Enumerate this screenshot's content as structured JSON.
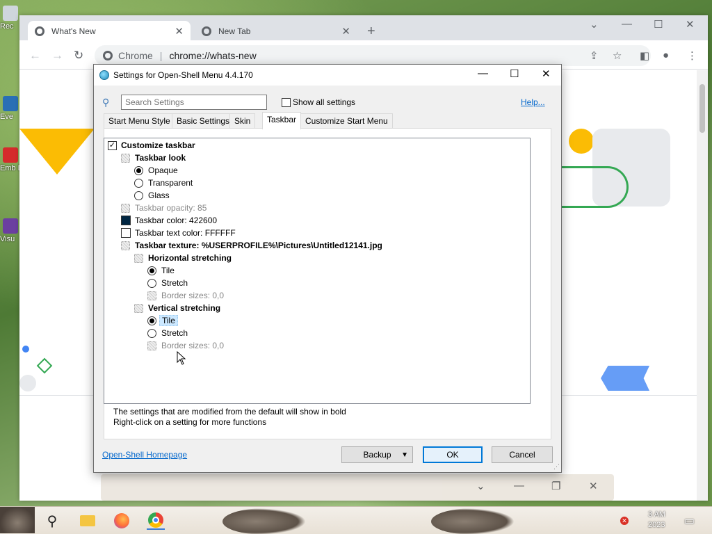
{
  "desktop": {
    "icons": [
      "Rec",
      "Eve",
      "Emb De",
      "Visu"
    ]
  },
  "chrome": {
    "tabs": [
      {
        "label": "What's New",
        "active": true
      },
      {
        "label": "New Tab",
        "active": false
      }
    ],
    "omnibox": {
      "site": "Chrome",
      "url": "chrome://whats-new"
    }
  },
  "dialog": {
    "title": "Settings for Open-Shell Menu 4.4.170",
    "search_placeholder": "Search Settings",
    "show_all_label": "Show all settings",
    "help_label": "Help...",
    "tabs": [
      "Start Menu Style",
      "Basic Settings",
      "Skin",
      "Taskbar",
      "Customize Start Menu"
    ],
    "active_tab": "Taskbar",
    "tree": {
      "customize_taskbar": "Customize taskbar",
      "taskbar_look": "Taskbar look",
      "opaque": "Opaque",
      "transparent": "Transparent",
      "glass": "Glass",
      "taskbar_opacity": "Taskbar opacity: 85",
      "taskbar_color": "Taskbar color: 422600",
      "taskbar_text_color": "Taskbar text color: FFFFFF",
      "taskbar_texture": "Taskbar texture: %USERPROFILE%\\Pictures\\Untitled12141.jpg",
      "horizontal_stretching": "Horizontal stretching",
      "h_tile": "Tile",
      "h_stretch": "Stretch",
      "h_border": "Border sizes: 0,0",
      "vertical_stretching": "Vertical stretching",
      "v_tile": "Tile",
      "v_stretch": "Stretch",
      "v_border": "Border sizes: 0,0"
    },
    "colors": {
      "taskbar_color": "#002642",
      "taskbar_text_color": "#FFFFFF"
    },
    "hint_line1": "The settings that are modified from the default will show in bold",
    "hint_line2": "Right-click on a setting for more functions",
    "homepage_label": "Open-Shell Homepage",
    "backup_label": "Backup",
    "ok_label": "OK",
    "cancel_label": "Cancel"
  },
  "taskbar": {
    "clock_time": "3 AM",
    "clock_date": "2023"
  }
}
